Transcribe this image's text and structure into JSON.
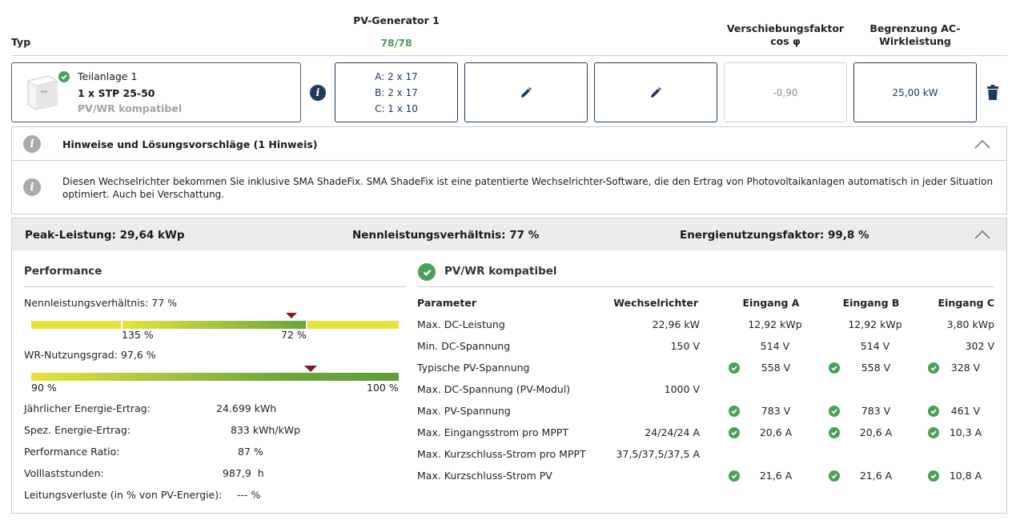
{
  "header": {
    "typ": "Typ",
    "pv_generator": "PV-Generator 1",
    "pv_count": "78/78",
    "verschiebung_1": "Verschiebungsfaktor",
    "verschiebung_2": "cos φ",
    "begrenzung_1": "Begrenzung AC-",
    "begrenzung_2": "Wirkleistung"
  },
  "inverter": {
    "name": "Teilanlage 1",
    "model": "1 x STP 25-50",
    "status": "PV/WR kompatibel",
    "strings": [
      "A: 2 x 17",
      "B: 2 x 17",
      "C: 1 x 10"
    ],
    "cos_phi": "-0,90",
    "ac_limit": "25,00 kW"
  },
  "hints": {
    "title": "Hinweise und Lösungsvorschläge (1 Hinweis)",
    "text": "Diesen Wechselrichter bekommen Sie inklusive SMA ShadeFix. SMA ShadeFix ist eine patentierte Wechselrichter-Software, die den Ertrag von Photovoltaikanlagen automatisch in jeder Situation optimiert. Auch bei Verschattung."
  },
  "summary": {
    "peak": "Peak-Leistung: 29,64 kWp",
    "ratio": "Nennleistungsverhältnis: 77 %",
    "factor": "Energienutzungsfaktor: 99,8 %"
  },
  "performance": {
    "title": "Performance",
    "nenn_label": "Nennleistungsverhältnis: 77 %",
    "nenn_tick1": "135 %",
    "nenn_tick2": "72 %",
    "wr_label": "WR-Nutzungsgrad: 97,6 %",
    "wr_min": "90 %",
    "wr_max": "100 %",
    "rows": [
      {
        "label": "Jährlicher Energie-Ertrag:",
        "value": "24.699 kWh"
      },
      {
        "label": "Spez. Energie-Ertrag:",
        "value": "833 kWh/kWp"
      },
      {
        "label": "Performance Ratio:",
        "value": "87 %"
      },
      {
        "label": "Volllaststunden:",
        "value": "987,9  h"
      },
      {
        "label": "Leitungsverluste (in % von PV-Energie):",
        "value": "--- %"
      }
    ]
  },
  "compat": {
    "title": "PV/WR kompatibel",
    "headers": [
      "Parameter",
      "Wechselrichter",
      "Eingang A",
      "Eingang B",
      "Eingang C"
    ],
    "rows": [
      {
        "p": "Max. DC-Leistung",
        "wr": "22,96 kW",
        "a": "12,92 kWp",
        "b": "12,92 kWp",
        "c": "3,80 kWp",
        "chk": false
      },
      {
        "p": "Min. DC-Spannung",
        "wr": "150 V",
        "a": "514 V",
        "b": "514 V",
        "c": "302 V",
        "chk": false
      },
      {
        "p": "Typische PV-Spannung",
        "wr": "",
        "a": "558 V",
        "b": "558 V",
        "c": "328 V",
        "chk": true
      },
      {
        "p": "Max. DC-Spannung (PV-Modul)",
        "wr": "1000 V",
        "a": "",
        "b": "",
        "c": "",
        "chk": false
      },
      {
        "p": "Max. PV-Spannung",
        "wr": "",
        "a": "783 V",
        "b": "783 V",
        "c": "461 V",
        "chk": true
      },
      {
        "p": "Max. Eingangsstrom pro MPPT",
        "wr": "24/24/24 A",
        "a": "20,6 A",
        "b": "20,6 A",
        "c": "10,3 A",
        "chk": true
      },
      {
        "p": "Max. Kurzschluss-Strom pro MPPT",
        "wr": "37,5/37,5/37,5 A",
        "a": "",
        "b": "",
        "c": "",
        "chk": false
      },
      {
        "p": "Max. Kurzschluss-Strom PV",
        "wr": "",
        "a": "21,6 A",
        "b": "21,6 A",
        "c": "10,8 A",
        "chk": true
      }
    ]
  },
  "colors": {
    "accent": "#4a9a59",
    "navy": "#1f3a5a",
    "bar_yellow": "#e6e33c",
    "bar_green": "#6aa63b",
    "marker": "#7b1a22"
  }
}
